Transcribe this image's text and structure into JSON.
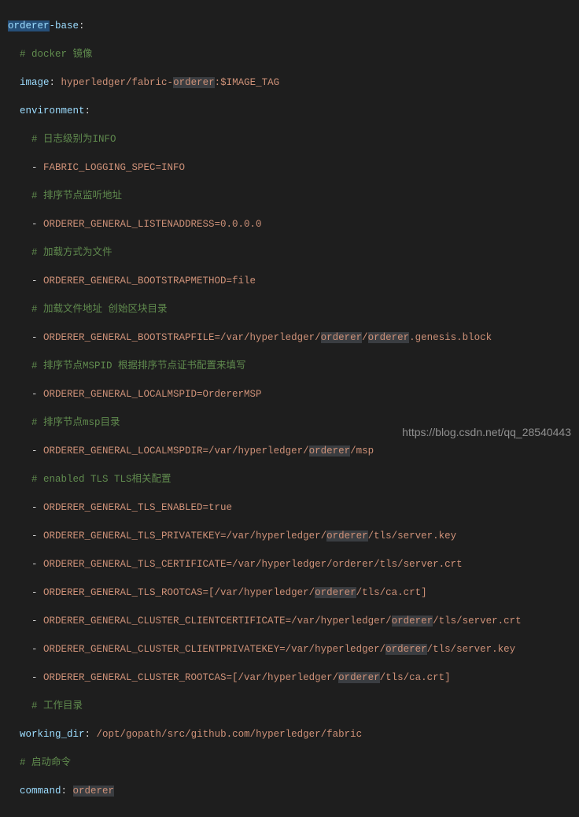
{
  "chart_data": {
    "type": "table",
    "title": "orderer-base",
    "rows": [
      {
        "key": "image",
        "value": "hyperledger/fabric-orderer:$IMAGE_TAG",
        "comment": "docker 镜像"
      },
      {
        "key": "environment",
        "value": [
          {
            "comment": "日志级别为INFO",
            "var": "FABRIC_LOGGING_SPEC=INFO"
          },
          {
            "comment": "排序节点监听地址",
            "var": "ORDERER_GENERAL_LISTENADDRESS=0.0.0.0"
          },
          {
            "comment": "加载方式为文件",
            "var": "ORDERER_GENERAL_BOOTSTRAPMETHOD=file"
          },
          {
            "comment": "加载文件地址 创始区块目录",
            "var": "ORDERER_GENERAL_BOOTSTRAPFILE=/var/hyperledger/orderer/orderer.genesis.block"
          },
          {
            "comment": "排序节点MSPID 根据排序节点证书配置来填写",
            "var": "ORDERER_GENERAL_LOCALMSPID=OrdererMSP"
          },
          {
            "comment": "排序节点msp目录",
            "var": "ORDERER_GENERAL_LOCALMSPDIR=/var/hyperledger/orderer/msp"
          },
          {
            "comment": "enabled TLS TLS相关配置",
            "var": "ORDERER_GENERAL_TLS_ENABLED=true"
          },
          {
            "var": "ORDERER_GENERAL_TLS_PRIVATEKEY=/var/hyperledger/orderer/tls/server.key"
          },
          {
            "var": "ORDERER_GENERAL_TLS_CERTIFICATE=/var/hyperledger/orderer/tls/server.crt"
          },
          {
            "var": "ORDERER_GENERAL_TLS_ROOTCAS=[/var/hyperledger/orderer/tls/ca.crt]"
          },
          {
            "var": "ORDERER_GENERAL_CLUSTER_CLIENTCERTIFICATE=/var/hyperledger/orderer/tls/server.crt"
          },
          {
            "var": "ORDERER_GENERAL_CLUSTER_CLIENTPRIVATEKEY=/var/hyperledger/orderer/tls/server.key"
          },
          {
            "var": "ORDERER_GENERAL_CLUSTER_ROOTCAS=[/var/hyperledger/orderer/tls/ca.crt]"
          }
        ]
      },
      {
        "key": "working_dir",
        "value": "/opt/gopath/src/github.com/hyperledger/fabric",
        "comment": "工作目录"
      },
      {
        "key": "command",
        "value": "orderer",
        "comment": "启动命令"
      }
    ]
  },
  "l1": {
    "a": "orderer",
    "b": "-base",
    "c": ":"
  },
  "l2": "  # docker 镜像",
  "l3": {
    "k": "  image",
    "c": ":",
    "v1": " hyperledger/fabric-",
    "v2": "orderer",
    "v3": ":$IMAGE_TAG"
  },
  "l4": {
    "k": "  environment",
    "c": ":"
  },
  "l5": "    # 日志级别为INFO",
  "l6": {
    "d": "    - ",
    "v": "FABRIC_LOGGING_SPEC=INFO"
  },
  "l7": "    # 排序节点监听地址",
  "l8": {
    "d": "    - ",
    "v": "ORDERER_GENERAL_LISTENADDRESS=0.0.0.0"
  },
  "l9": "    # 加载方式为文件",
  "l10": {
    "d": "    - ",
    "v": "ORDERER_GENERAL_BOOTSTRAPMETHOD=file"
  },
  "l11": "    # 加载文件地址 创始区块目录",
  "l12": {
    "d": "    - ",
    "v1": "ORDERER_GENERAL_BOOTSTRAPFILE=/var/hyperledger/",
    "h1": "orderer",
    "v2": "/",
    "h2": "orderer",
    "v3": ".genesis.block"
  },
  "l13": "    # 排序节点MSPID 根据排序节点证书配置来填写",
  "l14": {
    "d": "    - ",
    "v": "ORDERER_GENERAL_LOCALMSPID=OrdererMSP"
  },
  "l15": "    # 排序节点msp目录",
  "l16": {
    "d": "    - ",
    "v1": "ORDERER_GENERAL_LOCALMSPDIR=/var/hyperledger/",
    "h": "orderer",
    "v2": "/msp"
  },
  "l17": "    # enabled TLS TLS相关配置",
  "l18": {
    "d": "    - ",
    "v": "ORDERER_GENERAL_TLS_ENABLED=true"
  },
  "l19": {
    "d": "    - ",
    "v1": "ORDERER_GENERAL_TLS_PRIVATEKEY=/var/hyperledger/",
    "h": "orderer",
    "v2": "/tls/server.key"
  },
  "l20": {
    "d": "    - ",
    "v1": "ORDERER_GENERAL_TLS_CERTIFICATE=/var/hyperledger/orderer/tls/server.crt"
  },
  "l21": {
    "d": "    - ",
    "v1": "ORDERER_GENERAL_TLS_ROOTCAS=[/var/hyperledger/",
    "h": "orderer",
    "v2": "/tls/ca.crt]"
  },
  "l22": {
    "d": "    - ",
    "v1": "ORDERER_GENERAL_CLUSTER_CLIENTCERTIFICATE=/var/hyperledger/",
    "h": "orderer",
    "v2": "/tls/server.crt"
  },
  "l23": {
    "d": "    - ",
    "v1": "ORDERER_GENERAL_CLUSTER_CLIENTPRIVATEKEY=/var/hyperledger/",
    "h": "orderer",
    "v2": "/tls/server.key"
  },
  "l24": {
    "d": "    - ",
    "v1": "ORDERER_GENERAL_CLUSTER_ROOTCAS=[/var/hyperledger/",
    "h": "orderer",
    "v2": "/tls/ca.crt]"
  },
  "l25": "    # 工作目录",
  "l26": {
    "k": "  working_dir",
    "c": ":",
    "v": " /opt/gopath/src/github.com/hyperledger/fabric"
  },
  "l27": "  # 启动命令",
  "l28": {
    "k": "  command",
    "c": ":",
    "sp": " ",
    "v": "orderer"
  },
  "watermark": "https://blog.csdn.net/qq_28540443"
}
